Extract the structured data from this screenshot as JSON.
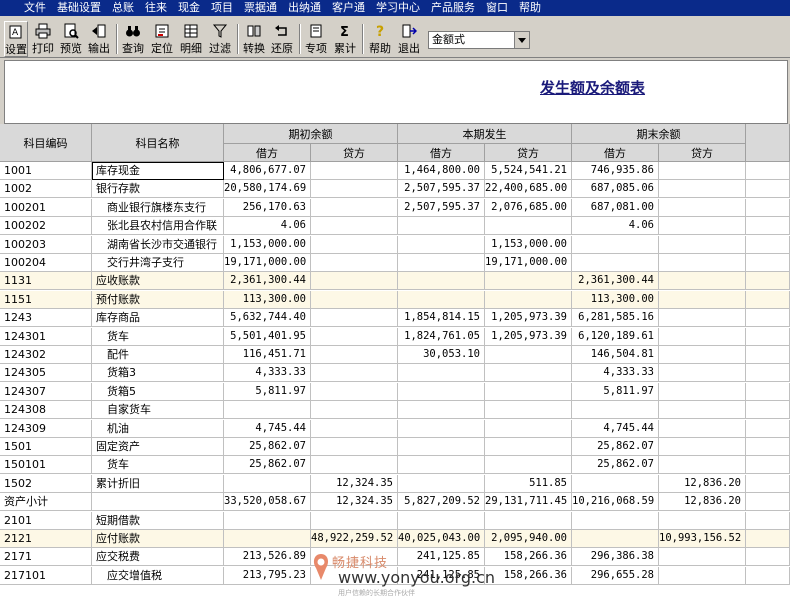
{
  "menu": [
    "文件",
    "基础设置",
    "总账",
    "往来",
    "现金",
    "项目",
    "票据通",
    "出纳通",
    "客户通",
    "学习中心",
    "产品服务",
    "窗口",
    "帮助"
  ],
  "toolbar": {
    "buttons": [
      {
        "label": "设置",
        "icon": "settings-icon"
      },
      {
        "label": "打印",
        "icon": "print-icon"
      },
      {
        "label": "预览",
        "icon": "preview-icon"
      },
      {
        "label": "输出",
        "icon": "export-icon"
      },
      {
        "label": "查询",
        "icon": "binoculars-icon"
      },
      {
        "label": "定位",
        "icon": "locate-icon"
      },
      {
        "label": "明细",
        "icon": "detail-icon"
      },
      {
        "label": "过滤",
        "icon": "filter-icon"
      },
      {
        "label": "转换",
        "icon": "convert-icon"
      },
      {
        "label": "还原",
        "icon": "restore-icon"
      },
      {
        "label": "专项",
        "icon": "special-icon"
      },
      {
        "label": "累计",
        "icon": "sigma-icon"
      },
      {
        "label": "帮助",
        "icon": "help-icon"
      },
      {
        "label": "退出",
        "icon": "exit-icon"
      }
    ],
    "format_value": "金额式"
  },
  "report": {
    "title": "发生额及余额表",
    "headers": {
      "code": "科目编码",
      "name": "科目名称",
      "opening": "期初余额",
      "current": "本期发生",
      "closing": "期末余额",
      "debit": "借方",
      "credit": "贷方"
    },
    "rows": [
      {
        "code": "1001",
        "name": "库存现金",
        "od": "4,806,677.07",
        "oc": "",
        "cd": "1,464,800.00",
        "cc": "5,524,541.21",
        "ed": "746,935.86",
        "ec": "",
        "sel": true
      },
      {
        "code": "1002",
        "name": "银行存款",
        "od": "20,580,174.69",
        "oc": "",
        "cd": "2,507,595.37",
        "cc": "22,400,685.00",
        "ed": "687,085.06",
        "ec": ""
      },
      {
        "code": "100201",
        "name": "　商业银行旗楼东支行",
        "od": "256,170.63",
        "oc": "",
        "cd": "2,507,595.37",
        "cc": "2,076,685.00",
        "ed": "687,081.00",
        "ec": ""
      },
      {
        "code": "100202",
        "name": "　张北县农村信用合作联",
        "od": "4.06",
        "oc": "",
        "cd": "",
        "cc": "",
        "ed": "4.06",
        "ec": ""
      },
      {
        "code": "100203",
        "name": "　湖南省长沙市交通银行",
        "od": "1,153,000.00",
        "oc": "",
        "cd": "",
        "cc": "1,153,000.00",
        "ed": "",
        "ec": ""
      },
      {
        "code": "100204",
        "name": "　交行井湾子支行",
        "od": "19,171,000.00",
        "oc": "",
        "cd": "",
        "cc": "19,171,000.00",
        "ed": "",
        "ec": ""
      },
      {
        "code": "1131",
        "name": "应收账款",
        "od": "2,361,300.44",
        "oc": "",
        "cd": "",
        "cc": "",
        "ed": "2,361,300.44",
        "ec": "",
        "hl": true
      },
      {
        "code": "1151",
        "name": "预付账款",
        "od": "113,300.00",
        "oc": "",
        "cd": "",
        "cc": "",
        "ed": "113,300.00",
        "ec": "",
        "hl": true
      },
      {
        "code": "1243",
        "name": "库存商品",
        "od": "5,632,744.40",
        "oc": "",
        "cd": "1,854,814.15",
        "cc": "1,205,973.39",
        "ed": "6,281,585.16",
        "ec": ""
      },
      {
        "code": "124301",
        "name": "　货车",
        "od": "5,501,401.95",
        "oc": "",
        "cd": "1,824,761.05",
        "cc": "1,205,973.39",
        "ed": "6,120,189.61",
        "ec": ""
      },
      {
        "code": "124302",
        "name": "　配件",
        "od": "116,451.71",
        "oc": "",
        "cd": "30,053.10",
        "cc": "",
        "ed": "146,504.81",
        "ec": ""
      },
      {
        "code": "124305",
        "name": "　货箱3",
        "od": "4,333.33",
        "oc": "",
        "cd": "",
        "cc": "",
        "ed": "4,333.33",
        "ec": ""
      },
      {
        "code": "124307",
        "name": "　货箱5",
        "od": "5,811.97",
        "oc": "",
        "cd": "",
        "cc": "",
        "ed": "5,811.97",
        "ec": ""
      },
      {
        "code": "124308",
        "name": "　自家货车",
        "od": "",
        "oc": "",
        "cd": "",
        "cc": "",
        "ed": "",
        "ec": ""
      },
      {
        "code": "124309",
        "name": "　机油",
        "od": "4,745.44",
        "oc": "",
        "cd": "",
        "cc": "",
        "ed": "4,745.44",
        "ec": ""
      },
      {
        "code": "1501",
        "name": "固定资产",
        "od": "25,862.07",
        "oc": "",
        "cd": "",
        "cc": "",
        "ed": "25,862.07",
        "ec": ""
      },
      {
        "code": "150101",
        "name": "　货车",
        "od": "25,862.07",
        "oc": "",
        "cd": "",
        "cc": "",
        "ed": "25,862.07",
        "ec": ""
      },
      {
        "code": "1502",
        "name": "累计折旧",
        "od": "",
        "oc": "12,324.35",
        "cd": "",
        "cc": "511.85",
        "ed": "",
        "ec": "12,836.20"
      },
      {
        "code": "资产小计",
        "name": "",
        "od": "33,520,058.67",
        "oc": "12,324.35",
        "cd": "5,827,209.52",
        "cc": "29,131,711.45",
        "ed": "10,216,068.59",
        "ec": "12,836.20"
      },
      {
        "code": "2101",
        "name": "短期借款",
        "od": "",
        "oc": "",
        "cd": "",
        "cc": "",
        "ed": "",
        "ec": ""
      },
      {
        "code": "2121",
        "name": "应付账款",
        "od": "",
        "oc": "48,922,259.52",
        "cd": "40,025,043.00",
        "cc": "2,095,940.00",
        "ed": "",
        "ec": "10,993,156.52",
        "hl": true
      },
      {
        "code": "2171",
        "name": "应交税费",
        "od": "213,526.89",
        "oc": "",
        "cd": "241,125.85",
        "cc": "158,266.36",
        "ed": "296,386.38",
        "ec": ""
      },
      {
        "code": "217101",
        "name": "　应交增值税",
        "od": "213,795.23",
        "oc": "",
        "cd": "241,125.85",
        "cc": "158,266.36",
        "ed": "296,655.28",
        "ec": ""
      }
    ]
  },
  "watermark": {
    "brand": "畅捷科技",
    "url": "www.yonyou.org.cn",
    "sub": "用户信赖的长期合作伙伴"
  }
}
